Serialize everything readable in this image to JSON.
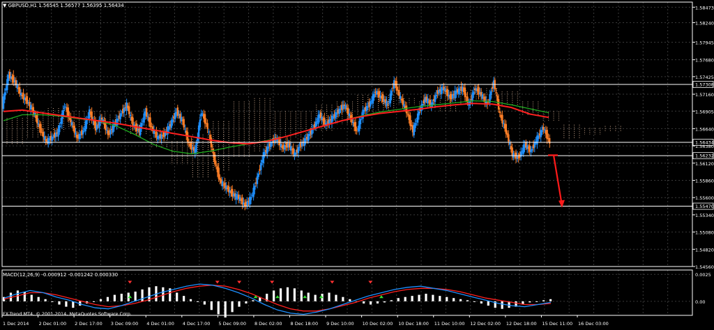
{
  "header": {
    "symbol_timeframe": "GBPUSD,H1",
    "ohlc": "1.56545 1.56577 1.56395 1.56434"
  },
  "indicator": {
    "label": "MACD(12,26,9)",
    "values": "-0.000912 -0.001242 0.000330"
  },
  "copyright": "FX-Trend MT4, © 2001-2014, MetaQuotes Software Corp.",
  "colors": {
    "background": "#000000",
    "grid": "#3a3a3a",
    "bull_candle": "#1e90ff",
    "bear_candle": "#ff7f27",
    "ma_fast": "#ff2020",
    "ma_slow": "#1faa1f",
    "cloud": "#f2c7a6",
    "arrow": "#ff1a1a",
    "macd_line": "#1e90ff",
    "signal_line": "#ff2020",
    "level_line": "#ffffff"
  },
  "chart_data": {
    "type": "candlestick",
    "symbol": "GBPUSD",
    "timeframe": "H1",
    "y_ticks": [
      "1.58473",
      "1.58240",
      "1.57945",
      "1.57680",
      "1.57425",
      "1.57160",
      "1.56905",
      "1.56640",
      "1.56380",
      "1.56120",
      "1.55860",
      "1.55600",
      "1.55340",
      "1.55080",
      "1.54820",
      "1.54560"
    ],
    "ylim": [
      1.5456,
      1.5855
    ],
    "x_ticks": [
      "1 Dec 2014",
      "2 Dec 01:00",
      "2 Dec 17:00",
      "3 Dec 09:00",
      "4 Dec 01:00",
      "4 Dec 17:00",
      "5 Dec 09:00",
      "8 Dec 02:00",
      "8 Dec 18:00",
      "9 Dec 10:00",
      "10 Dec 02:00",
      "10 Dec 18:00",
      "11 Dec 10:00",
      "12 Dec 02:00",
      "12 Dec 18:00",
      "15 Dec 11:00",
      "16 Dec 03:00"
    ],
    "horizontal_levels": [
      {
        "value": 1.57308,
        "label": "1.57308"
      },
      {
        "value": 1.56434,
        "label": "1.56434"
      },
      {
        "value": 1.56232,
        "label": "1.56232"
      },
      {
        "value": 1.5547,
        "label": "1.55470"
      }
    ],
    "close_path": [
      1.57,
      1.5745,
      1.5735,
      1.5715,
      1.5705,
      1.569,
      1.5665,
      1.5645,
      1.565,
      1.566,
      1.57,
      1.5675,
      1.565,
      1.566,
      1.569,
      1.5665,
      1.568,
      1.5655,
      1.567,
      1.5685,
      1.57,
      1.567,
      1.566,
      1.569,
      1.5665,
      1.565,
      1.5655,
      1.567,
      1.569,
      1.5675,
      1.564,
      1.563,
      1.569,
      1.5665,
      1.562,
      1.5585,
      1.5575,
      1.5565,
      1.556,
      1.5548,
      1.556,
      1.559,
      1.5625,
      1.564,
      1.565,
      1.5635,
      1.564,
      1.5625,
      1.564,
      1.565,
      1.5665,
      1.5685,
      1.567,
      1.568,
      1.569,
      1.57,
      1.568,
      1.566,
      1.569,
      1.57,
      1.572,
      1.571,
      1.57,
      1.5735,
      1.571,
      1.569,
      1.566,
      1.569,
      1.571,
      1.57,
      1.572,
      1.5725,
      1.571,
      1.572,
      1.5725,
      1.57,
      1.5725,
      1.5715,
      1.57,
      1.5735,
      1.5685,
      1.566,
      1.5625,
      1.562,
      1.564,
      1.563,
      1.565,
      1.5665,
      1.5643
    ],
    "ma_fast": [
      1.569,
      1.5692,
      1.5688,
      1.5684,
      1.568,
      1.5676,
      1.5672,
      1.5667,
      1.5662,
      1.5657,
      1.5652,
      1.5647,
      1.5643,
      1.5641,
      1.5645,
      1.5652,
      1.566,
      1.5668,
      1.5676,
      1.5682,
      1.5687,
      1.569,
      1.5693,
      1.5697,
      1.57,
      1.5702,
      1.5701,
      1.5696,
      1.5686,
      1.5681
    ],
    "ma_slow": [
      1.5676,
      1.5685,
      1.5685,
      1.5683,
      1.5679,
      1.5676,
      1.5668,
      1.5655,
      1.564,
      1.563,
      1.5626,
      1.563,
      1.5636,
      1.5641,
      1.5646,
      1.5652,
      1.566,
      1.5668,
      1.5676,
      1.5683,
      1.5689,
      1.5693,
      1.5697,
      1.57,
      1.5703,
      1.5706,
      1.5705,
      1.57,
      1.5694,
      1.5688
    ],
    "cloud_upper": [
      1.568,
      1.569,
      1.5695,
      1.569,
      1.569,
      1.5685,
      1.567,
      1.565,
      1.5645,
      1.5655,
      1.5675,
      1.5705,
      1.571,
      1.569,
      1.569,
      1.57,
      1.5705,
      1.5715,
      1.5715,
      1.571,
      1.5705,
      1.572,
      1.5722,
      1.5725,
      1.572,
      1.5705,
      1.569,
      1.567,
      1.5665,
      1.5668
    ],
    "cloud_lower": [
      1.564,
      1.565,
      1.566,
      1.5665,
      1.567,
      1.567,
      1.5655,
      1.5635,
      1.561,
      1.559,
      1.56,
      1.562,
      1.563,
      1.564,
      1.565,
      1.566,
      1.567,
      1.5685,
      1.569,
      1.57,
      1.5695,
      1.569,
      1.57,
      1.571,
      1.57,
      1.5685,
      1.5675,
      1.565,
      1.5655,
      1.566
    ],
    "arrow_signal": {
      "direction": "down",
      "from": 1.5624,
      "to": 1.5548
    },
    "macd": {
      "ylim": [
        -0.0013,
        0.0029
      ],
      "y_ticks": [
        "0.0025",
        "0.00"
      ],
      "histogram": [
        0.0004,
        0.0008,
        0.001,
        0.0009,
        0.0006,
        0.0004,
        0.0002,
        0.0,
        -0.0003,
        -0.0005,
        -0.0006,
        -0.0004,
        -0.0002,
        0.0,
        0.0002,
        0.0004,
        0.0006,
        0.0007,
        0.0008,
        0.0009,
        0.0011,
        0.0013,
        0.0014,
        0.0013,
        0.0012,
        0.0008,
        0.0005,
        0.0002,
        0.0,
        -0.0003,
        -0.0008,
        -0.0012,
        -0.0015,
        -0.001,
        -0.0005,
        -0.0002,
        0.0001,
        0.0004,
        0.0007,
        0.001,
        0.0012,
        0.0013,
        0.0012,
        0.001,
        0.0008,
        0.0006,
        0.0007,
        0.0008,
        0.0006,
        0.0004,
        0.0002,
        0.0,
        -0.0002,
        -0.0003,
        -0.0002,
        -0.0001,
        0.0001,
        0.0003,
        0.0004,
        0.0005,
        0.0006,
        0.0007,
        0.0006,
        0.0005,
        0.0004,
        0.0003,
        0.0002,
        0.0001,
        0.0,
        -0.0002,
        -0.0004,
        -0.0006,
        -0.0007,
        -0.0006,
        -0.0005,
        -0.0003,
        -0.0001,
        0.0,
        0.0001,
        0.0002
      ],
      "macd_line": [
        0.0003,
        0.0007,
        0.001,
        0.0008,
        0.0004,
        0.0001,
        -0.0003,
        -0.0006,
        -0.0007,
        -0.0004,
        0.0,
        0.0004,
        0.0008,
        0.0011,
        0.0014,
        0.0016,
        0.0015,
        0.0012,
        0.0008,
        0.0003,
        -0.0003,
        -0.0008,
        -0.0011,
        -0.0012,
        -0.001,
        -0.0007,
        -0.0003,
        0.0001,
        0.0005,
        0.0008,
        0.0011,
        0.0013,
        0.0014,
        0.0012,
        0.001,
        0.0007,
        0.0004,
        0.0001,
        -0.0002,
        -0.0004,
        -0.0005,
        -0.0003,
        -0.0001
      ],
      "signal_line": [
        0.0002,
        0.0005,
        0.0008,
        0.0008,
        0.0006,
        0.0003,
        0.0,
        -0.0003,
        -0.0005,
        -0.0004,
        -0.0002,
        0.0001,
        0.0005,
        0.0009,
        0.0012,
        0.0014,
        0.0015,
        0.0014,
        0.0011,
        0.0007,
        0.0002,
        -0.0003,
        -0.0007,
        -0.0009,
        -0.0009,
        -0.0007,
        -0.0004,
        -0.0001,
        0.0003,
        0.0006,
        0.0009,
        0.0011,
        0.0012,
        0.0012,
        0.0011,
        0.0009,
        0.0006,
        0.0003,
        0.0001,
        -0.0001,
        -0.0003,
        -0.0003,
        -0.0002
      ],
      "up_arrows": [
        0.23,
        0.46,
        0.5,
        0.55,
        0.58,
        0.69
      ],
      "down_arrows": [
        0.23,
        0.39,
        0.43,
        0.49,
        0.6,
        0.67
      ]
    }
  }
}
